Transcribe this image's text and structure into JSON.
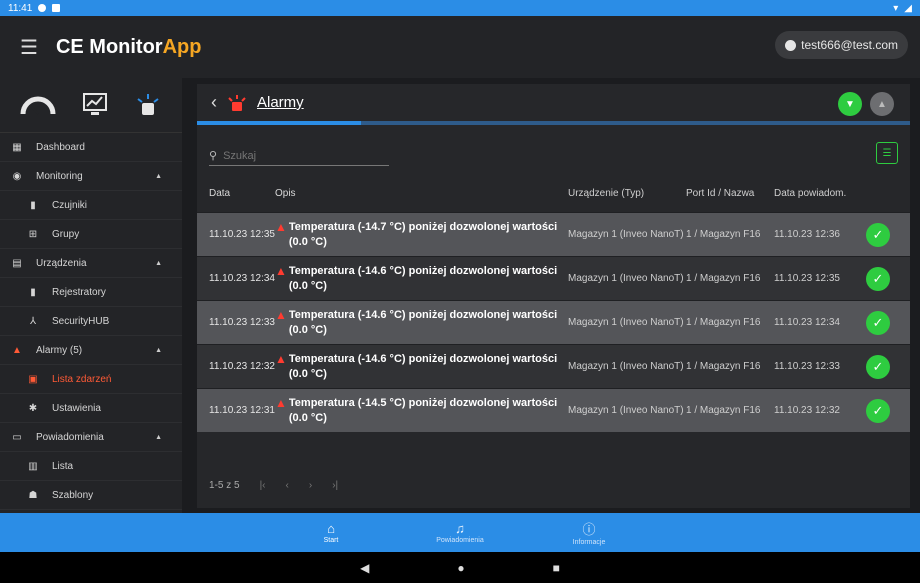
{
  "status_bar": {
    "time": "11:41"
  },
  "app": {
    "title_main": "CE Monitor",
    "title_accent": "App",
    "user": "test666@test.com"
  },
  "sidebar": {
    "items": [
      {
        "label": "Dashboard",
        "icon": "dashboard-icon"
      },
      {
        "label": "Monitoring",
        "icon": "eye-icon"
      },
      {
        "label": "Czujniki",
        "icon": "thermometer-icon"
      },
      {
        "label": "Grupy",
        "icon": "group-icon"
      },
      {
        "label": "Urządzenia",
        "icon": "device-icon"
      },
      {
        "label": "Rejestratory",
        "icon": "thermometer-icon"
      },
      {
        "label": "SecurityHUB",
        "icon": "hub-icon"
      },
      {
        "label": "Alarmy (5)",
        "icon": "alarm-icon"
      },
      {
        "label": "Lista zdarzeń",
        "icon": "list-icon"
      },
      {
        "label": "Ustawienia",
        "icon": "gear-icon"
      },
      {
        "label": "Powiadomienia",
        "icon": "message-icon"
      },
      {
        "label": "Lista",
        "icon": "list-icon"
      },
      {
        "label": "Szablony",
        "icon": "template-icon"
      }
    ]
  },
  "page": {
    "title": "Alarmy",
    "progress_percent": 23
  },
  "search": {
    "placeholder": "Szukaj"
  },
  "table": {
    "headers": {
      "date": "Data",
      "desc": "Opis",
      "device": "Urządzenie (Typ)",
      "port": "Port Id / Nazwa",
      "ndate": "Data powiadom."
    },
    "rows": [
      {
        "date": "11.10.23 12:35",
        "desc": "Temperatura (-14.7 °C) poniżej dozwolonej wartości (0.0 °C)",
        "device": "Magazyn 1 (Inveo NanoT)",
        "port": "1 / Magazyn F16",
        "ndate": "11.10.23 12:36"
      },
      {
        "date": "11.10.23 12:34",
        "desc": "Temperatura (-14.6 °C) poniżej dozwolonej wartości (0.0 °C)",
        "device": "Magazyn 1 (Inveo NanoT)",
        "port": "1 / Magazyn F16",
        "ndate": "11.10.23 12:35"
      },
      {
        "date": "11.10.23 12:33",
        "desc": "Temperatura (-14.6 °C) poniżej dozwolonej wartości (0.0 °C)",
        "device": "Magazyn 1 (Inveo NanoT)",
        "port": "1 / Magazyn F16",
        "ndate": "11.10.23 12:34"
      },
      {
        "date": "11.10.23 12:32",
        "desc": "Temperatura (-14.6 °C) poniżej dozwolonej wartości (0.0 °C)",
        "device": "Magazyn 1 (Inveo NanoT)",
        "port": "1 / Magazyn F16",
        "ndate": "11.10.23 12:33"
      },
      {
        "date": "11.10.23 12:31",
        "desc": "Temperatura (-14.5 °C) poniżej dozwolonej wartości (0.0 °C)",
        "device": "Magazyn 1 (Inveo NanoT)",
        "port": "1 / Magazyn F16",
        "ndate": "11.10.23 12:32"
      }
    ]
  },
  "pager": {
    "range": "1-5 z 5"
  },
  "bottom_nav": {
    "start": "Start",
    "notifications": "Powiadomienia",
    "info": "Informacje"
  },
  "colors": {
    "accent": "#f5a623",
    "primary": "#2b8de6",
    "success": "#2ecc40",
    "alert": "#ff3b30"
  }
}
